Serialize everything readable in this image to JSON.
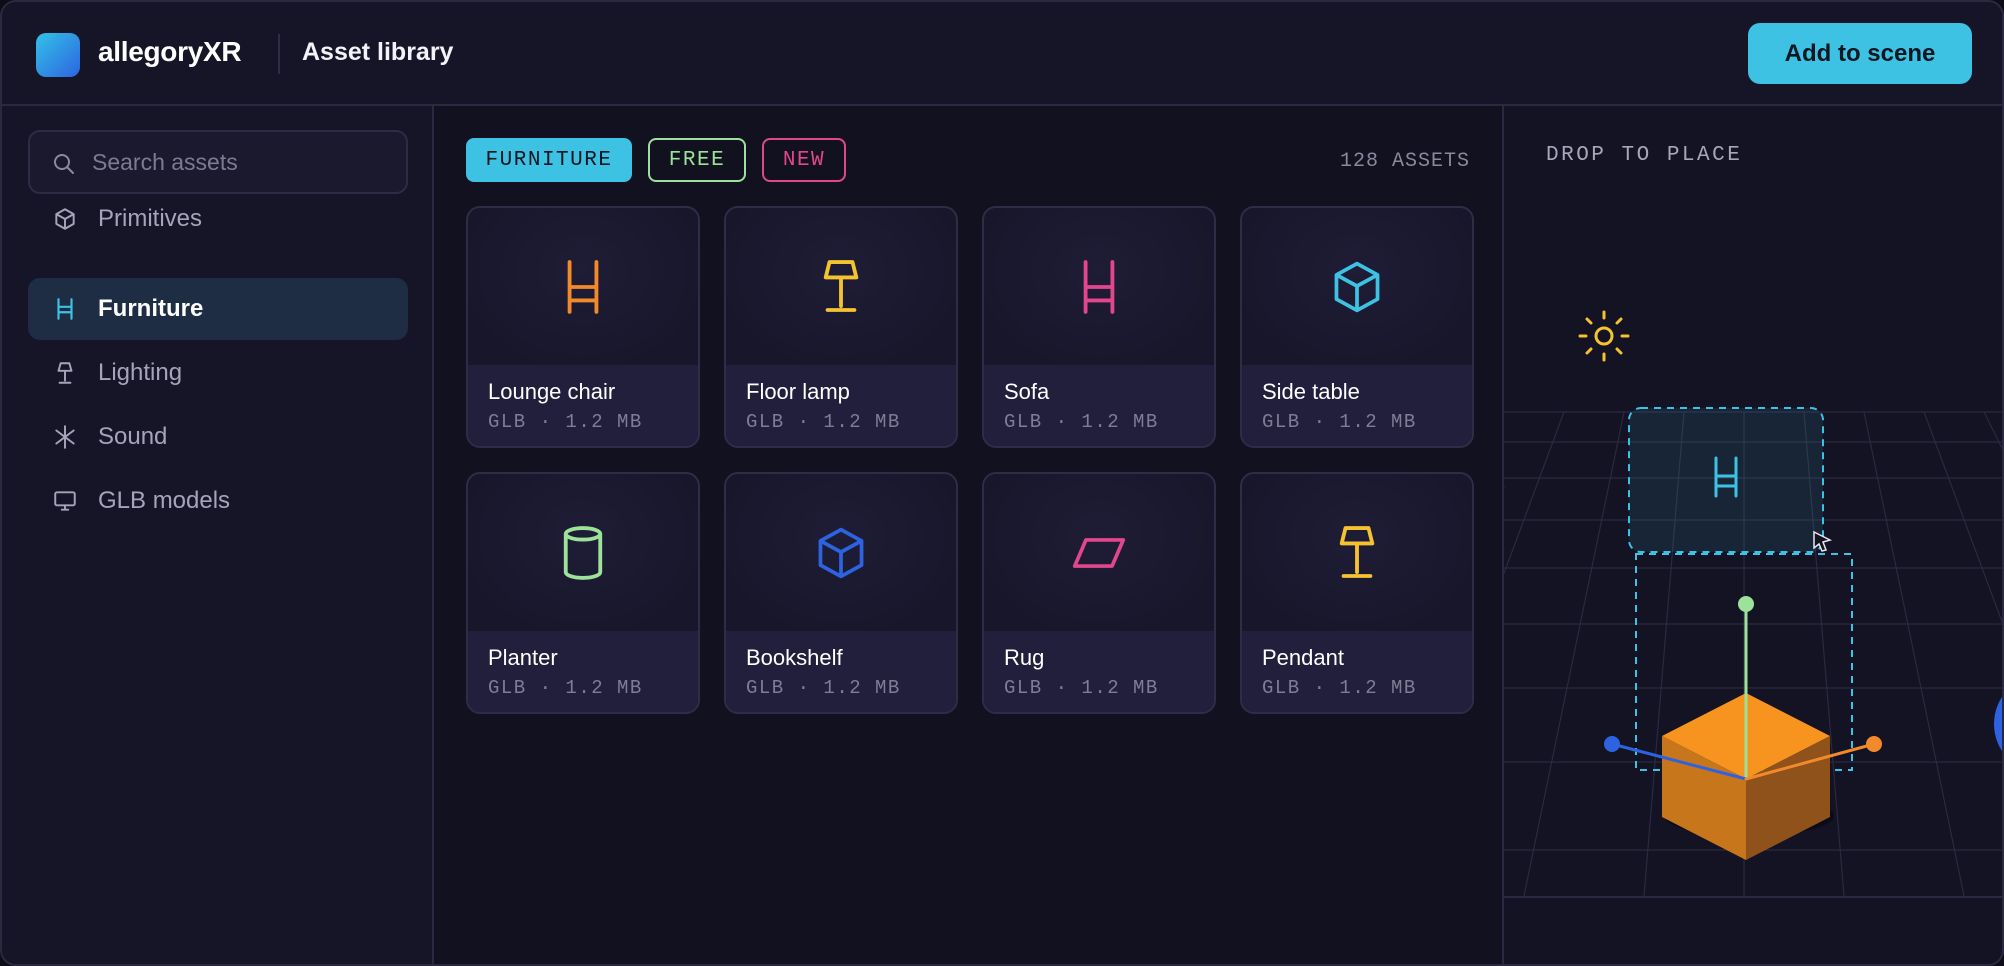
{
  "header": {
    "brand": "allegoryXR",
    "title": "Asset library",
    "add_button": "Add to scene"
  },
  "sidebar": {
    "search_placeholder": "Search assets",
    "items": [
      {
        "label": "Primitives",
        "icon": "cube-icon",
        "active": false
      },
      {
        "label": "Furniture",
        "icon": "chair-icon",
        "active": true
      },
      {
        "label": "Lighting",
        "icon": "lamp-icon",
        "active": false
      },
      {
        "label": "Sound",
        "icon": "asterisk-icon",
        "active": false
      },
      {
        "label": "GLB models",
        "icon": "monitor-icon",
        "active": false
      }
    ]
  },
  "filters": {
    "chips": [
      "FURNITURE",
      "FREE",
      "NEW"
    ],
    "active_chip": "FURNITURE",
    "count": "128 ASSETS"
  },
  "assets": [
    {
      "name": "Lounge chair",
      "meta": "GLB · 1.2 MB",
      "icon": "chair-icon",
      "color": "#f28a2a"
    },
    {
      "name": "Floor lamp",
      "meta": "GLB · 1.2 MB",
      "icon": "lamp-icon",
      "color": "#f5c330"
    },
    {
      "name": "Sofa",
      "meta": "GLB · 1.2 MB",
      "icon": "chair-icon",
      "color": "#e2478e"
    },
    {
      "name": "Side table",
      "meta": "GLB · 1.2 MB",
      "icon": "cube-icon",
      "color": "#3ec2e4"
    },
    {
      "name": "Planter",
      "meta": "GLB · 1.2 MB",
      "icon": "cylinder-icon",
      "color": "#9ce29a"
    },
    {
      "name": "Bookshelf",
      "meta": "GLB · 1.2 MB",
      "icon": "cube-icon",
      "color": "#2d63e0"
    },
    {
      "name": "Rug",
      "meta": "GLB · 1.2 MB",
      "icon": "parallelogram-icon",
      "color": "#e2478e"
    },
    {
      "name": "Pendant",
      "meta": "GLB · 1.2 MB",
      "icon": "lamp-icon",
      "color": "#f5c330"
    }
  ],
  "scene": {
    "drop_label": "DROP TO PLACE"
  },
  "colors": {
    "accent": "#3ec2e4",
    "orange": "#f28a2a",
    "yellow": "#f5c330",
    "pink": "#e2478e",
    "green": "#9ce29a",
    "blue": "#2d63e0"
  }
}
